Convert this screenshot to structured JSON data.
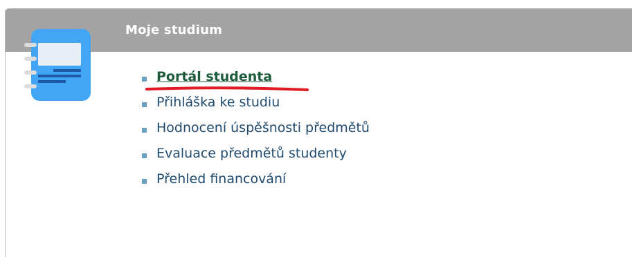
{
  "header": {
    "title": "Moje studium",
    "icon": "notebook-icon",
    "color": "#a3a3a3"
  },
  "menu": {
    "items": [
      {
        "label": "Portál studenta",
        "active": true
      },
      {
        "label": "Přihláška ke studiu"
      },
      {
        "label": "Hodnocení úspěšnosti předmětů"
      },
      {
        "label": "Evaluace předmětů studenty"
      },
      {
        "label": "Přehled financování"
      }
    ]
  },
  "annotation": {
    "type": "red-underline",
    "color": "#e01b24"
  }
}
